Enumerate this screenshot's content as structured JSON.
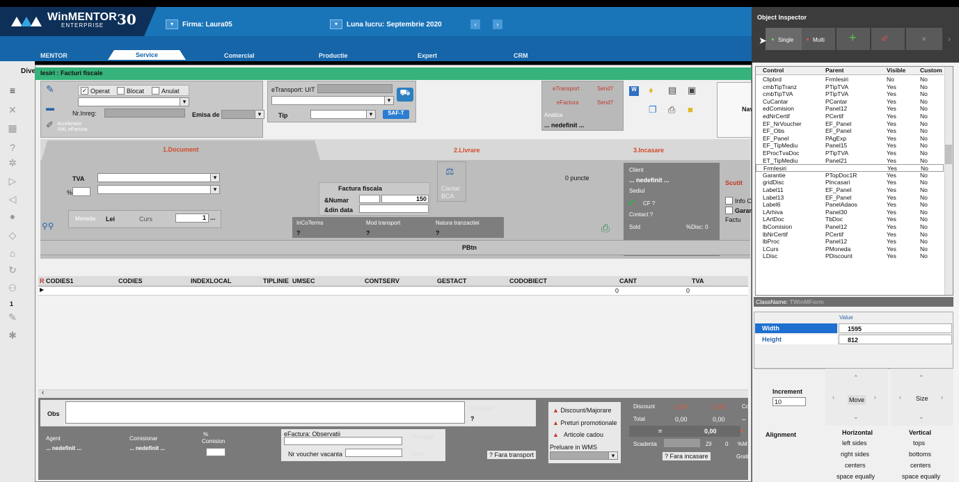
{
  "header": {
    "logo": "WinMENTOR",
    "logo_sub": "ENTERPRISE",
    "logo_30": "30",
    "firma": "Firma: Laura05",
    "luna": "Luna lucru: Septembrie 2020"
  },
  "tabs": [
    "MENTOR",
    "Service",
    "Comercial",
    "Productie",
    "Expert",
    "CRM"
  ],
  "left": {
    "dive": "Dive",
    "num": "1"
  },
  "window": {
    "title": "Iesiri : Facturi fiscale",
    "checks": {
      "operat": "Operat",
      "blocat": "Blocat",
      "anulat": "Anulat"
    },
    "nr_inreg": "Nr.Inreg:",
    "emisa_de": "Emisa de",
    "etransport": "eTransport: UIT",
    "tip": "Tip",
    "saft": "SAF-T",
    "accelerator": "Accelerator",
    "xml_efactura": "XML eFactura",
    "btn_etransport": "eTransport",
    "btn_send1": "Send?",
    "btn_efactura": "eFactura",
    "btn_send2": "Send?",
    "analiza": "Analiza",
    "nedefinit": "... nedefinit ...",
    "nav": "Nav",
    "tab_document": "1.Document",
    "tab_livrare": "2.Livrare",
    "tab_incasare": "3.Incasare",
    "tva": "TVA",
    "pct": "%",
    "moneda": "Moneda",
    "lei": "Lei",
    "curs": "Curs",
    "curs_val": "1",
    "curs_btn": "...",
    "factura_fiscale": "Factura fiscala",
    "numar": "&Numar",
    "numar_val": "150",
    "din_data": "&din data",
    "cantar": "Cantar",
    "bca": "BCA",
    "puncte": "0 puncte",
    "incoterms": "InCoTerms",
    "mod_transport": "Mod transport",
    "natura": "Natura tranzactiei",
    "q": "?",
    "client": "Client",
    "client_val": "... nedefinit ...",
    "sediul": "Sediul",
    "cf": "CF ?",
    "contact": "Contact ?",
    "sold": "Sold",
    "disc": "%Disc: 0",
    "scutit": "Scutit",
    "info_c": "Info C",
    "garan": "Garan",
    "factu": "Factu",
    "pbtn": "PBtn"
  },
  "grid": {
    "columns": [
      "CODIES1",
      "CODIES",
      "INDEXLOCAL",
      "TIPLINIE",
      "UMSEC",
      "CONTSERV",
      "GESTACT",
      "CODOBIECT",
      "CANT",
      "TVA"
    ],
    "r": "R",
    "cant": "0",
    "tva": "0"
  },
  "bottom": {
    "obs": "Obs",
    "contract": "Contract",
    "contract_q": "?",
    "agent": "Agent",
    "agent_val": "... nedefinit ...",
    "comisionar": "Comisionar",
    "comisionar_val": "... nedefinit ...",
    "pct": "%",
    "comision": "Comision",
    "efactura_obs": "eFactura: Observatii",
    "nr_voucher": "Nr voucher vacanta",
    "delegat": "Delegat",
    "auto": "Auto",
    "fara_transport": "? Fara transport",
    "discount_majorare": "Discount/Majorare",
    "preturi": "Preturi promotionale",
    "articole": "Articole cadou",
    "preluare": "Preluare in WMS",
    "discount": "Discount",
    "total": "Total",
    "d1": "0,00",
    "d2": "0,00",
    "t1": "0,00",
    "t2": "0,00",
    "eq": "=",
    "eqv": "0,00",
    "scadenta": "Scadenta",
    "zil": "Zil",
    "zil_val": "0",
    "pm": "%M",
    "fara_incasare": "? Fara incasare",
    "grati": "Grati",
    "co": "Co"
  },
  "oi": {
    "title": "Object Inspector",
    "single": "Single",
    "multi": "Multi",
    "cols": [
      "Control",
      "Parent",
      "Visible",
      "Custom"
    ],
    "rows": [
      [
        "Clipbrd",
        "FrmIesiri",
        "No",
        "No"
      ],
      [
        "cmbTipTranz",
        "PTipTVA",
        "Yes",
        "No"
      ],
      [
        "cmbTipTVA",
        "PTipTVA",
        "Yes",
        "No"
      ],
      [
        "CuCantar",
        "PCantar",
        "Yes",
        "No"
      ],
      [
        "edComision",
        "Panel12",
        "Yes",
        "No"
      ],
      [
        "edNrCertif",
        "PCertif",
        "Yes",
        "No"
      ],
      [
        "EF_NrVoucher",
        "EF_Panel",
        "Yes",
        "No"
      ],
      [
        "EF_Obs",
        "EF_Panel",
        "Yes",
        "No"
      ],
      [
        "EF_Panel",
        "PAgExp",
        "Yes",
        "No"
      ],
      [
        "EF_TipMediu",
        "Panel15",
        "Yes",
        "No"
      ],
      [
        "EProcTvaDoc",
        "PTipTVA",
        "Yes",
        "No"
      ],
      [
        "ET_TipMediu",
        "Panel21",
        "Yes",
        "No"
      ],
      [
        "FrmIesiri",
        "",
        "Yes",
        "No"
      ],
      [
        "Garantie",
        "PTopDoc1R",
        "Yes",
        "No"
      ],
      [
        "gridDisc",
        "PIncasari",
        "Yes",
        "No"
      ],
      [
        "Label11",
        "EF_Panel",
        "Yes",
        "No"
      ],
      [
        "Label13",
        "EF_Panel",
        "Yes",
        "No"
      ],
      [
        "Label6",
        "PanelAdaos",
        "Yes",
        "No"
      ],
      [
        "LArhiva",
        "Panel30",
        "Yes",
        "No"
      ],
      [
        "LArtDoc",
        "TbDoc",
        "Yes",
        "No"
      ],
      [
        "lbComision",
        "Panel12",
        "Yes",
        "No"
      ],
      [
        "lbNrCertif",
        "PCertif",
        "Yes",
        "No"
      ],
      [
        "lbProc",
        "Panel12",
        "Yes",
        "No"
      ],
      [
        "LCurs",
        "PMoneda",
        "Yes",
        "No"
      ],
      [
        "LDisc",
        "PDiscount",
        "Yes",
        "No"
      ]
    ],
    "classname": "ClassName:",
    "classname_val": "TWinMForm",
    "value_hdr": "Value",
    "width": "Width",
    "width_val": "1595",
    "height": "Height",
    "height_val": "812",
    "increment": "Increment",
    "increment_val": "10",
    "move": "Move",
    "size": "Size",
    "alignment": "Alignment",
    "horizontal": "Horizontal",
    "vertical": "Vertical",
    "h_items": [
      "left sides",
      "right sides",
      "centers",
      "space equally"
    ],
    "v_items": [
      "tops",
      "bottoms",
      "centers",
      "space equally"
    ]
  }
}
